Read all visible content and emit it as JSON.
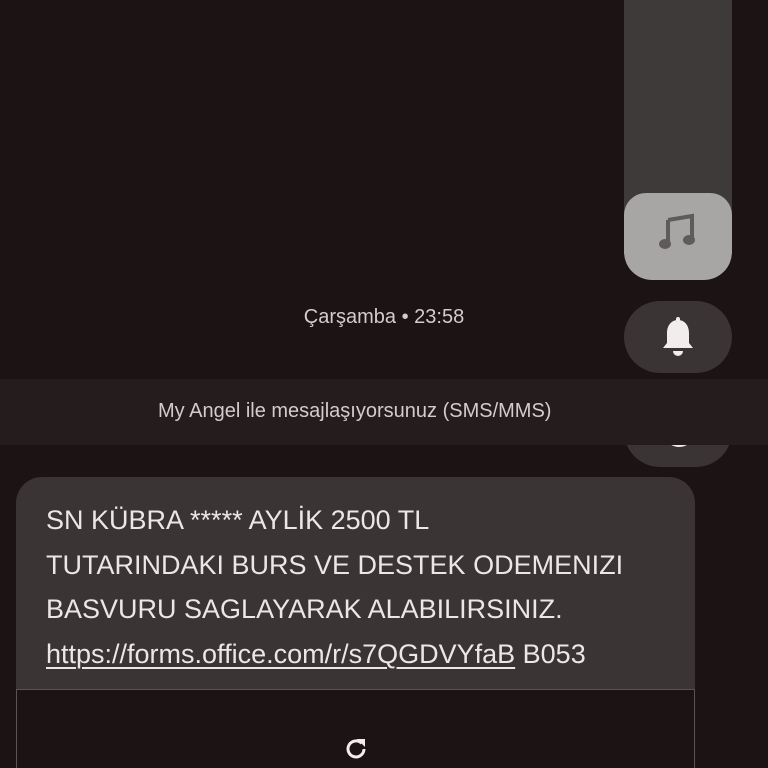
{
  "volume": {
    "level_fraction": 0.18,
    "icon": "music-note-icon"
  },
  "buttons": {
    "bell_icon": "bell-icon",
    "dnd_icon": "moon-icon"
  },
  "conversation": {
    "timestamp": "Çarşamba • 23:58",
    "banner": "My Angel ile mesajlaşıyorsunuz (SMS/MMS)"
  },
  "message": {
    "line1": "SN KÜBRA ***** AYLİK 2500 TL",
    "line2": "TUTARINDAKI BURS VE DESTEK ODEMENIZI",
    "line3": "BASVURU SAGLAYARAK ALABILIRSINIZ.",
    "link": "https://forms.office.com/r/s7QGDVYfaB",
    "suffix": " B053"
  },
  "preview": {
    "icon": "refresh-icon"
  },
  "colors": {
    "background": "#1c1314",
    "bubble": "#3a3434",
    "slider_fill": "#a8a5a5"
  }
}
